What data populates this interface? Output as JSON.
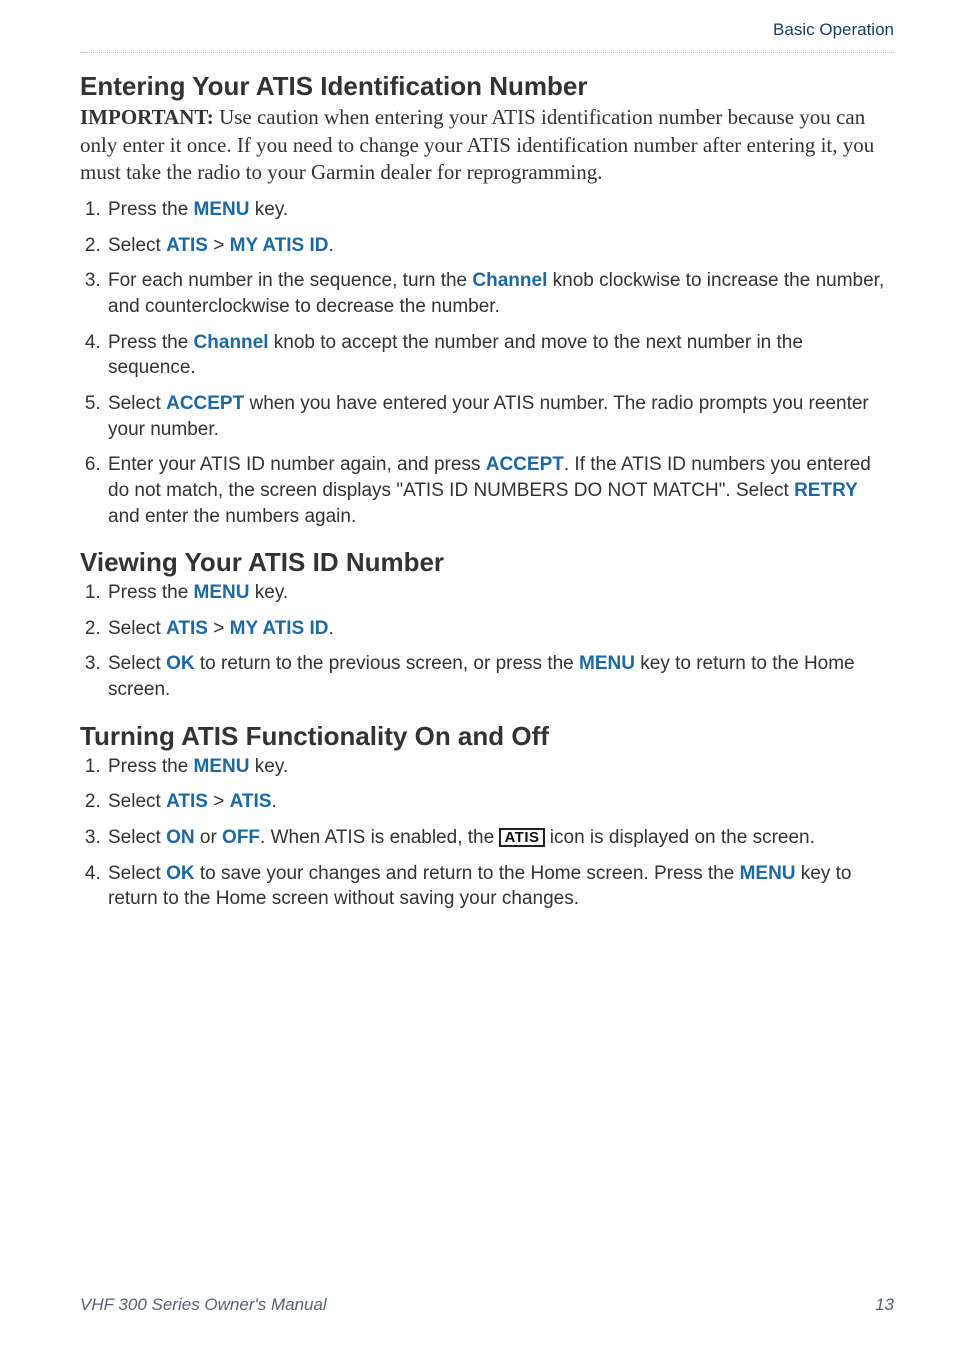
{
  "header": {
    "breadcrumb": "Basic Operation"
  },
  "sections": {
    "entering": {
      "title": "Entering Your ATIS Identification Number",
      "important_label": "IMPORTANT:",
      "important_text": " Use caution when entering your ATIS identification number because you can only enter it once. If you need to change your ATIS identification number after entering it, you must take the radio to your Garmin dealer for reprogramming.",
      "step1_a": "Press the ",
      "step1_kw_menu": "MENU",
      "step1_b": " key.",
      "step2_a": "Select ",
      "step2_kw_atis": "ATIS",
      "step2_sep": " > ",
      "step2_kw_myid": "MY ATIS ID",
      "step2_end": ".",
      "step3_a": "For each number in the sequence, turn the ",
      "step3_kw_channel": "Channel",
      "step3_b": " knob clockwise to increase the number, and counterclockwise to decrease the number.",
      "step4_a": "Press the ",
      "step4_kw_channel": "Channel",
      "step4_b": " knob to accept the number and move to the next number in the sequence.",
      "step5_a": "Select ",
      "step5_kw_accept": "ACCEPT",
      "step5_b": " when you have entered your ATIS number. The radio prompts you reenter your number.",
      "step6_a": "Enter your ATIS ID number again, and press ",
      "step6_kw_accept": "ACCEPT",
      "step6_b": ". If the ATIS ID numbers you entered do not match, the screen displays \"ATIS ID NUMBERS DO NOT MATCH\". Select ",
      "step6_kw_retry": "RETRY",
      "step6_c": " and enter the numbers again."
    },
    "viewing": {
      "title": "Viewing Your ATIS ID Number",
      "step1_a": "Press the ",
      "step1_kw_menu": "MENU",
      "step1_b": " key.",
      "step2_a": "Select ",
      "step2_kw_atis": "ATIS",
      "step2_sep": " > ",
      "step2_kw_myid": "MY ATIS ID",
      "step2_end": ".",
      "step3_a": "Select ",
      "step3_kw_ok": "OK",
      "step3_b": " to return to the previous screen, or press the ",
      "step3_kw_menu": "MENU",
      "step3_c": " key to return to the Home screen."
    },
    "turning": {
      "title": "Turning ATIS Functionality On and Off",
      "step1_a": "Press the ",
      "step1_kw_menu": "MENU",
      "step1_b": " key.",
      "step2_a": "Select ",
      "step2_kw_atis1": "ATIS",
      "step2_sep": " > ",
      "step2_kw_atis2": "ATIS",
      "step2_end": ".",
      "step3_a": "Select ",
      "step3_kw_on": "ON",
      "step3_mid1": " or ",
      "step3_kw_off": "OFF",
      "step3_mid2": ". When ATIS is enabled, the ",
      "step3_icon": "ATIS",
      "step3_b": " icon is displayed on the screen.",
      "step4_a": "Select ",
      "step4_kw_ok": "OK",
      "step4_b": " to save your changes and return to the Home screen. Press the ",
      "step4_kw_menu": "MENU",
      "step4_c": " key to return to the Home screen without saving your changes."
    }
  },
  "footer": {
    "left": "VHF 300 Series Owner's Manual",
    "right": "13"
  }
}
